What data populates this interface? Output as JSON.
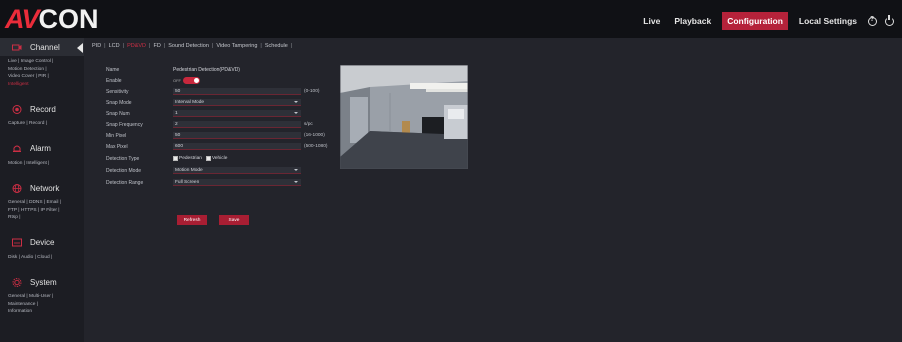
{
  "brand": {
    "logo_av": "AV",
    "logo_con": "CON",
    "accent": "#ea2c3a"
  },
  "nav": {
    "items": [
      {
        "label": "Live"
      },
      {
        "label": "Playback"
      },
      {
        "label": "Configuration",
        "active": true
      },
      {
        "label": "Local Settings"
      }
    ],
    "icons": [
      "help-icon",
      "power-icon"
    ]
  },
  "sidebar": {
    "sections": [
      {
        "title": "Channel",
        "icon": "camera-icon",
        "active": true,
        "links": [
          "Live | Image Control |",
          "Motion Detection |",
          "Video Cover | PIR |",
          "Intelligent"
        ]
      },
      {
        "title": "Record",
        "icon": "record-icon",
        "links": [
          "Capture | Record |"
        ]
      },
      {
        "title": "Alarm",
        "icon": "alarm-icon",
        "links": [
          "Motion | Intelligent |"
        ]
      },
      {
        "title": "Network",
        "icon": "network-icon",
        "links": [
          "General | DDNS | Email |",
          "FTP | HTTPS | IP Filter |",
          "Rtsp |"
        ]
      },
      {
        "title": "Device",
        "icon": "device-icon",
        "links": [
          "Disk | Audio | Cloud |"
        ]
      },
      {
        "title": "System",
        "icon": "system-icon",
        "links": [
          "General | Multi-User |",
          "Maintenance |",
          "Information"
        ]
      }
    ]
  },
  "tabs": [
    {
      "label": "PID"
    },
    {
      "label": "LCD"
    },
    {
      "label": "PD&VD",
      "active": true
    },
    {
      "label": "FD"
    },
    {
      "label": "Sound Detection"
    },
    {
      "label": "Video Tampering"
    },
    {
      "label": "Schedule"
    }
  ],
  "form": {
    "name": {
      "label": "Name",
      "value": "Pedestrian Detection(PD&VD)"
    },
    "enable": {
      "label": "Enable",
      "off_text": "OFF",
      "on": true
    },
    "sensitivity": {
      "label": "Sensitivity",
      "value": "50",
      "range": "(0-100)"
    },
    "snap_mode": {
      "label": "Snap Mode",
      "value": "Interval Mode"
    },
    "snap_num": {
      "label": "Snap Num",
      "value": "1"
    },
    "snap_frequency": {
      "label": "Snap Frequency",
      "value": "2",
      "unit": "s/pc"
    },
    "min_pixel": {
      "label": "Min Pixel",
      "value": "50",
      "range": "(16-1000)"
    },
    "max_pixel": {
      "label": "Max Pixel",
      "value": "600",
      "range": "(500-1080)"
    },
    "detection_type": {
      "label": "Detection Type",
      "options": [
        "Pedestrian",
        "Vehicle"
      ]
    },
    "detection_mode": {
      "label": "Detection Mode",
      "value": "Motion Mode"
    },
    "detection_range": {
      "label": "Detection Range",
      "value": "Full Screen"
    }
  },
  "buttons": {
    "refresh": "Refresh",
    "save": "Save"
  }
}
